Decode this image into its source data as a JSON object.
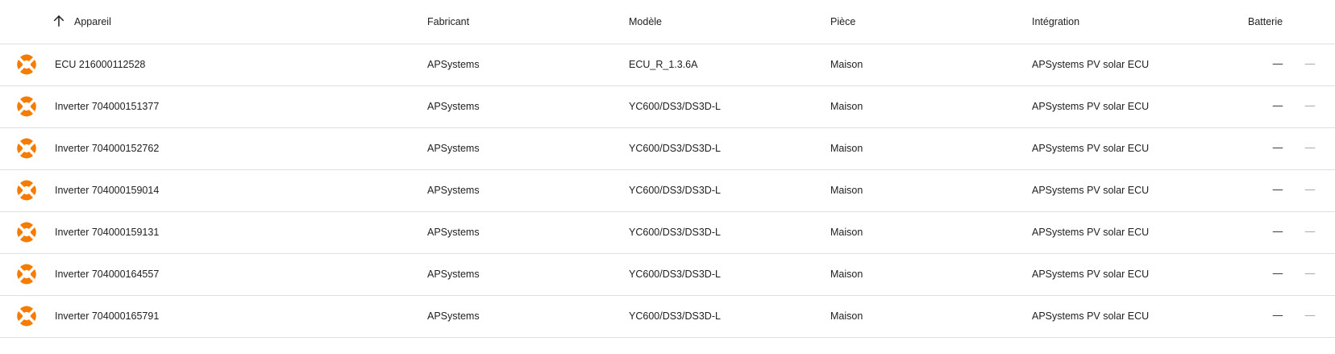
{
  "table": {
    "columns": {
      "device": "Appareil",
      "manufacturer": "Fabricant",
      "model": "Modèle",
      "room": "Pièce",
      "integration": "Intégration",
      "battery": "Batterie"
    },
    "sort_icon": "arrow-up-icon",
    "device_icon": "apsystems-logo-icon",
    "accent_color": "#f57c00",
    "rows": [
      {
        "device": "ECU 216000112528",
        "manufacturer": "APSystems",
        "model": "ECU_R_1.3.6A",
        "room": "Maison",
        "integration": "APSystems PV solar ECU",
        "battery": "—",
        "extra": "—"
      },
      {
        "device": "Inverter 704000151377",
        "manufacturer": "APSystems",
        "model": "YC600/DS3/DS3D-L",
        "room": "Maison",
        "integration": "APSystems PV solar ECU",
        "battery": "—",
        "extra": "—"
      },
      {
        "device": "Inverter 704000152762",
        "manufacturer": "APSystems",
        "model": "YC600/DS3/DS3D-L",
        "room": "Maison",
        "integration": "APSystems PV solar ECU",
        "battery": "—",
        "extra": "—"
      },
      {
        "device": "Inverter 704000159014",
        "manufacturer": "APSystems",
        "model": "YC600/DS3/DS3D-L",
        "room": "Maison",
        "integration": "APSystems PV solar ECU",
        "battery": "—",
        "extra": "—"
      },
      {
        "device": "Inverter 704000159131",
        "manufacturer": "APSystems",
        "model": "YC600/DS3/DS3D-L",
        "room": "Maison",
        "integration": "APSystems PV solar ECU",
        "battery": "—",
        "extra": "—"
      },
      {
        "device": "Inverter 704000164557",
        "manufacturer": "APSystems",
        "model": "YC600/DS3/DS3D-L",
        "room": "Maison",
        "integration": "APSystems PV solar ECU",
        "battery": "—",
        "extra": "—"
      },
      {
        "device": "Inverter 704000165791",
        "manufacturer": "APSystems",
        "model": "YC600/DS3/DS3D-L",
        "room": "Maison",
        "integration": "APSystems PV solar ECU",
        "battery": "—",
        "extra": "—"
      }
    ]
  }
}
